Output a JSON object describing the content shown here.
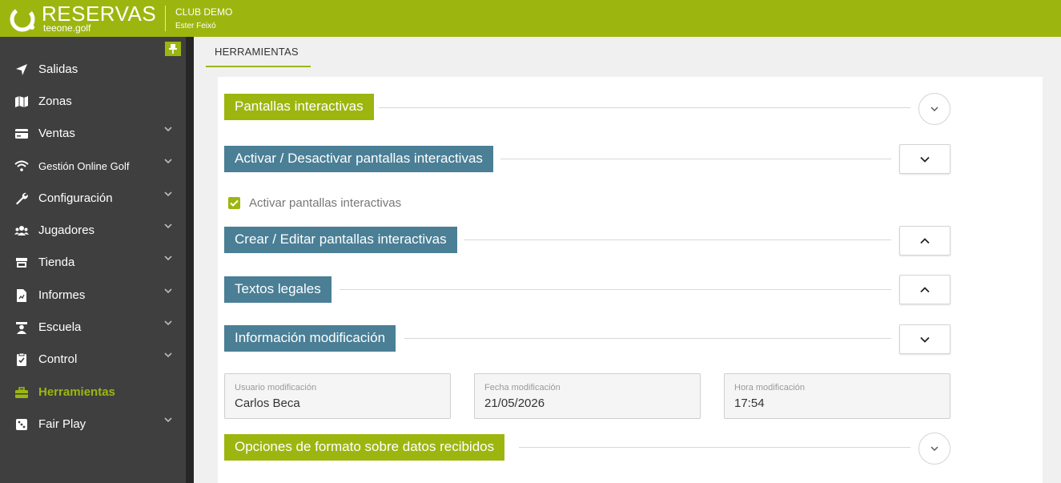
{
  "header": {
    "brand": "RESERVAS",
    "brand_sub": "teeone.golf",
    "club": "CLUB DEMO",
    "user": "Ester Feixó",
    "accent": "#9db60f"
  },
  "sidebar": {
    "items": [
      {
        "label": "Salidas",
        "icon": "navigation-arrow-icon",
        "has_submenu": false,
        "active": false
      },
      {
        "label": "Zonas",
        "icon": "map-icon",
        "has_submenu": false,
        "active": false
      },
      {
        "label": "Ventas",
        "icon": "cash-card-icon",
        "has_submenu": true,
        "active": false
      },
      {
        "label": "Gestión Online Golf",
        "icon": "wifi-icon",
        "has_submenu": true,
        "active": false
      },
      {
        "label": "Configuración",
        "icon": "wrench-icon",
        "has_submenu": true,
        "active": false
      },
      {
        "label": "Jugadores",
        "icon": "users-icon",
        "has_submenu": true,
        "active": false
      },
      {
        "label": "Tienda",
        "icon": "store-icon",
        "has_submenu": true,
        "active": false
      },
      {
        "label": "Informes",
        "icon": "report-icon",
        "has_submenu": true,
        "active": false
      },
      {
        "label": "Escuela",
        "icon": "teacher-icon",
        "has_submenu": true,
        "active": false
      },
      {
        "label": "Control",
        "icon": "clipboard-check-icon",
        "has_submenu": true,
        "active": false
      },
      {
        "label": "Herramientas",
        "icon": "toolbox-icon",
        "has_submenu": false,
        "active": true
      },
      {
        "label": "Fair Play",
        "icon": "dice-icon",
        "has_submenu": true,
        "active": false
      }
    ]
  },
  "tabs": {
    "active": "HERRAMIENTAS"
  },
  "sections": {
    "pantallas": "Pantallas interactivas",
    "activar": "Activar / Desactivar pantallas interactivas",
    "crear": "Crear / Editar pantallas interactivas",
    "textos": "Textos legales",
    "info": "Información modificación",
    "opciones": "Opciones de formato sobre datos recibidos"
  },
  "checkbox": {
    "label": "Activar pantallas interactivas",
    "checked": true
  },
  "fields": {
    "usuario": {
      "label": "Usuario modificación",
      "value": "Carlos Beca"
    },
    "fecha": {
      "label": "Fecha modificación",
      "value": "21/05/2026"
    },
    "hora": {
      "label": "Hora modificación",
      "value": "17:54"
    }
  },
  "colors": {
    "green": "#9db60f",
    "blue": "#4a7f96",
    "sidebar": "#3f3f3f"
  }
}
